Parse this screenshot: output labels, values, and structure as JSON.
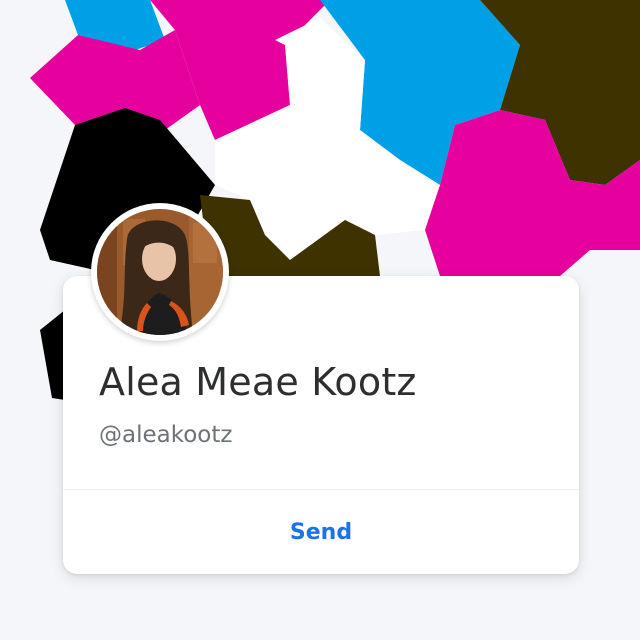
{
  "profile": {
    "name": "Alea Meae Kootz",
    "handle": "@aleakootz",
    "avatar_alt": "profile-photo"
  },
  "actions": {
    "send_label": "Send"
  },
  "colors": {
    "magenta": "#e6009e",
    "cyan": "#00a0e6",
    "olive_dark": "#3d3200",
    "black": "#000000",
    "white": "#ffffff",
    "page_bg": "#f4f6f9",
    "link_blue": "#1a73e8",
    "name_text": "#2c2e2f",
    "handle_text": "#6c7378"
  }
}
